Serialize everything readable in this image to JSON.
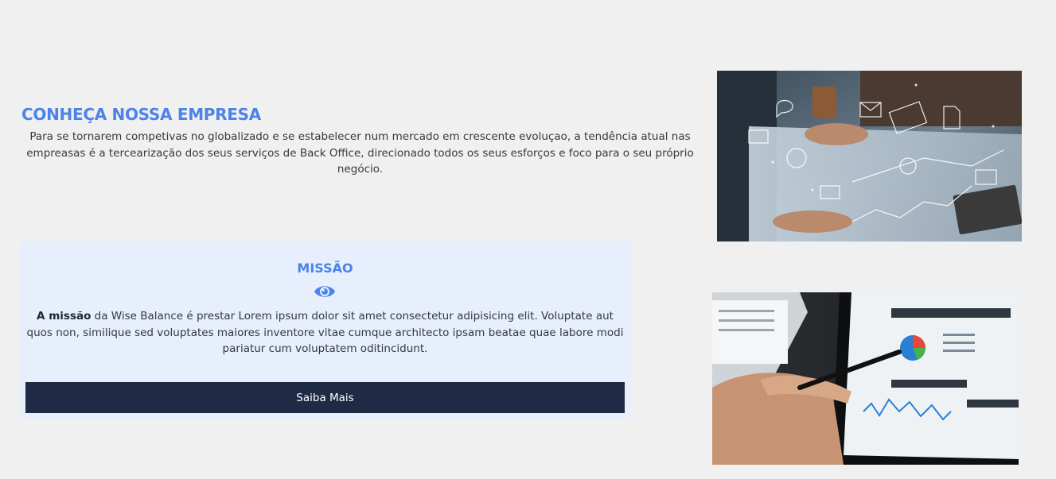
{
  "about": {
    "title": "CONHEÇA NOSSA EMPRESA",
    "text": "Para se tornarem competivas no globalizado e se estabelecer num mercado em crescente evoluçao, a tendência atual nas empreasas é a tercearização dos seus serviços de Back Office, direcionado todos os seus esforços e foco para o seu próprio negócio."
  },
  "mission": {
    "title": "MISSÃO",
    "icon": "eye-icon",
    "text_strong": "A missão",
    "text_rest": " da Wise Balance é prestar Lorem ipsum dolor sit amet consectetur adipisicing elit. Voluptate aut quos non, similique sed voluptates maiores inventore vitae cumque architecto ipsam beatae quae labore modi pariatur cum voluptatem oditincidunt.",
    "button_label": "Saiba Mais"
  },
  "colors": {
    "accent": "#4b83e8",
    "card_background": "#e7eefc",
    "button_background": "#1f2b45",
    "page_background": "#f1f0f0"
  }
}
